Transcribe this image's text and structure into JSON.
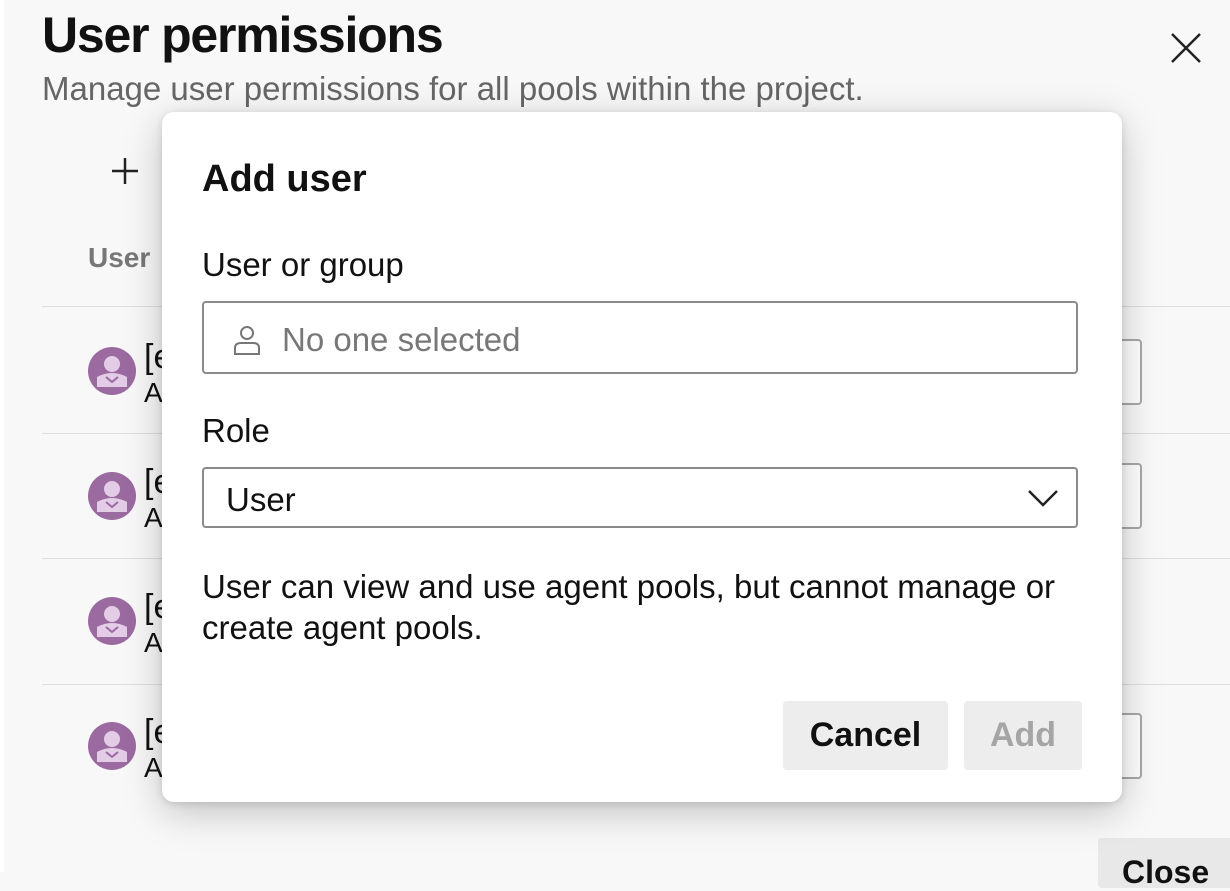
{
  "panel": {
    "title": "User permissions",
    "subtitle": "Manage user permissions for all pools within the project.",
    "column_header": "User",
    "rows": [
      {
        "line1": "[e",
        "line2": "A"
      },
      {
        "line1": "[e",
        "line2": "A"
      },
      {
        "line1": "[e",
        "line2": "A"
      },
      {
        "line1": "[e",
        "line2": "A"
      }
    ],
    "footer_button": "Close"
  },
  "dialog": {
    "title": "Add user",
    "identity_label": "User or group",
    "identity_placeholder": "No one selected",
    "role_label": "Role",
    "role_value": "User",
    "role_description": "User can view and use agent pools, but cannot manage or create agent pools.",
    "cancel_label": "Cancel",
    "add_label": "Add"
  },
  "colors": {
    "avatar": "#9a6aa0",
    "button_bg": "#ededed",
    "disabled_text": "#a5a5a5"
  },
  "icons": [
    "close-icon",
    "add-icon",
    "person-icon",
    "chevron-down-icon",
    "avatar-icon"
  ]
}
